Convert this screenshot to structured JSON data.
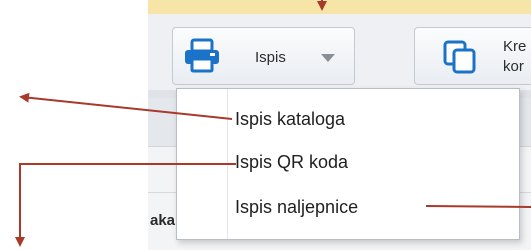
{
  "toolbar": {
    "print_button": {
      "label": "Ispis",
      "icon": "printer-icon"
    },
    "copy_button": {
      "label": "Kre\nkor",
      "icon": "copy-icon"
    }
  },
  "dropdown": {
    "items": [
      {
        "label": "Ispis kataloga"
      },
      {
        "label": "Ispis QR koda"
      },
      {
        "label": "Ispis naljepnice"
      }
    ]
  },
  "background": {
    "column_label": "aka"
  },
  "colors": {
    "arrow": "#a83a2c",
    "accent": "#f7e5a8",
    "printer_blue": "#1a73c8"
  }
}
